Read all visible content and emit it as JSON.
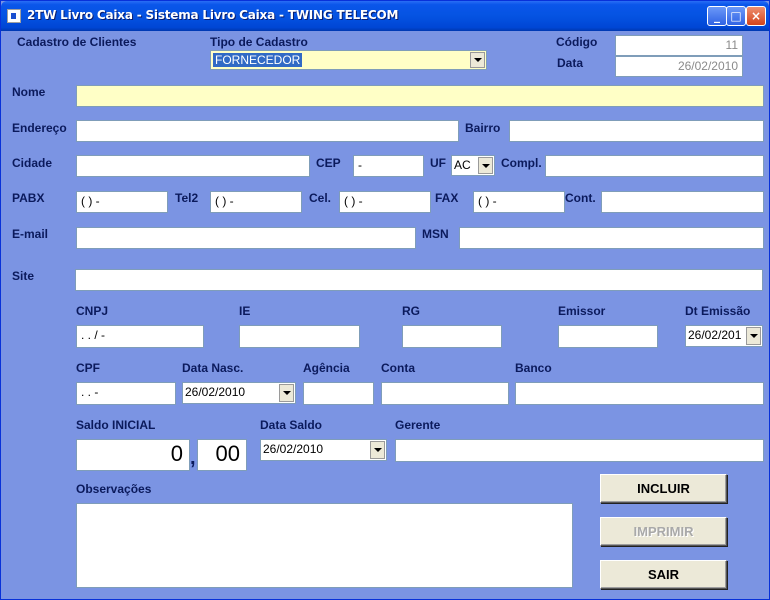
{
  "window": {
    "title": "2TW Livro Caixa - Sistema Livro Caixa - TWING TELECOM",
    "minimize_glyph": "_",
    "maximize_glyph": "□",
    "close_glyph": "×"
  },
  "header": {
    "cadastro_label": "Cadastro de Clientes",
    "tipo_label": "Tipo de Cadastro",
    "tipo_value": "FORNECEDOR",
    "codigo_label": "Código",
    "codigo_value": "11",
    "data_label": "Data",
    "data_value": "26/02/2010"
  },
  "fields": {
    "nome_label": "Nome",
    "endereco_label": "Endereço",
    "bairro_label": "Bairro",
    "cidade_label": "Cidade",
    "cep_label": "CEP",
    "cep_value": "  -",
    "uf_label": "UF",
    "uf_value": "AC",
    "compl_label": "Compl.",
    "pabx_label": "PABX",
    "pabx_value": "( )  -",
    "tel2_label": "Tel2",
    "tel2_value": "( )  -",
    "cel_label": "Cel.",
    "cel_value": "( )  -",
    "fax_label": "FAX",
    "fax_value": "( )  -",
    "cont_label": "Cont.",
    "email_label": "E-mail",
    "msn_label": "MSN",
    "site_label": "Site",
    "cnpj_label": "CNPJ",
    "cnpj_value": " .  .  /  -",
    "ie_label": "IE",
    "rg_label": "RG",
    "emissor_label": "Emissor",
    "dt_emissao_label": "Dt Emissão",
    "dt_emissao_value": "26/02/201",
    "cpf_label": "CPF",
    "cpf_value": " .  .  -",
    "data_nasc_label": "Data Nasc.",
    "data_nasc_value": "26/02/2010",
    "agencia_label": "Agência",
    "conta_label": "Conta",
    "banco_label": "Banco",
    "saldo_label": "Saldo INICIAL",
    "saldo_int": "0",
    "saldo_sep": ",",
    "saldo_dec": "00",
    "data_saldo_label": "Data Saldo",
    "data_saldo_value": "26/02/2010",
    "gerente_label": "Gerente",
    "obs_label": "Observações"
  },
  "buttons": {
    "incluir": "INCLUIR",
    "imprimir": "IMPRIMIR",
    "sair": "SAIR"
  }
}
